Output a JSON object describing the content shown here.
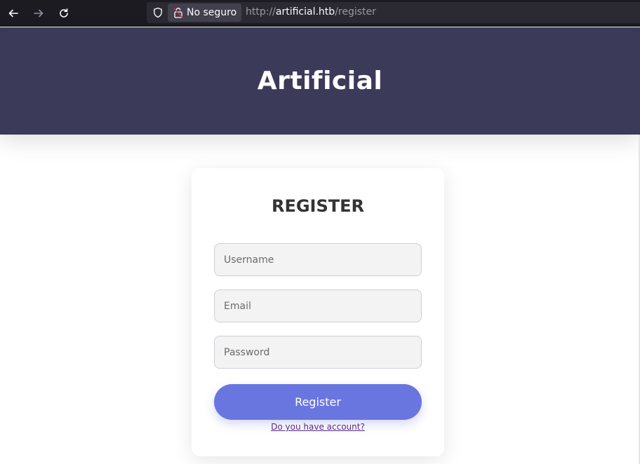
{
  "browser": {
    "security_label": "No seguro",
    "url_scheme": "http://",
    "url_host": "artificial.htb",
    "url_path": "/register",
    "icons": [
      "back-arrow-icon",
      "forward-arrow-icon",
      "reload-icon",
      "shield-icon",
      "broken-lock-icon"
    ]
  },
  "header": {
    "title": "Artificial",
    "background": "#3c3a59"
  },
  "form": {
    "heading": "REGISTER",
    "username_placeholder": "Username",
    "email_placeholder": "Email",
    "password_placeholder": "Password",
    "submit_label": "Register",
    "account_link": "Do you have account?",
    "accent": "#6a76e0"
  }
}
